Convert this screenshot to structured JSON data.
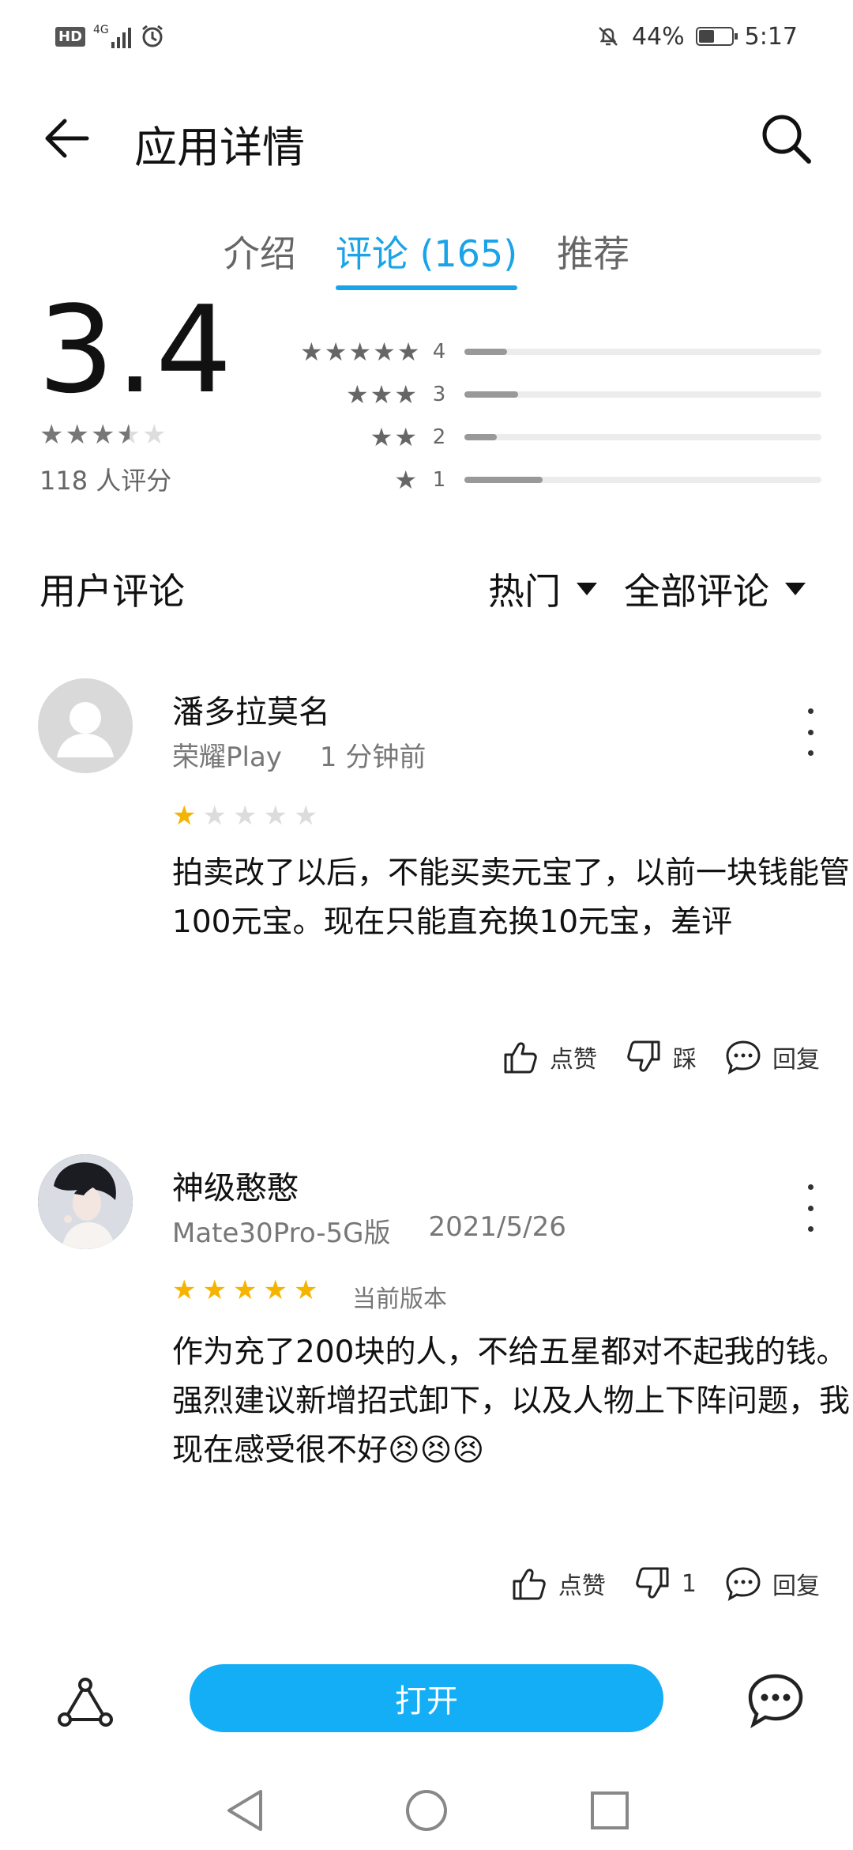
{
  "status": {
    "battery": "44%",
    "time": "5:17",
    "hd": "HD",
    "net": "4G"
  },
  "header": {
    "title": "应用详情"
  },
  "tabs": [
    {
      "label": "介绍"
    },
    {
      "label": "评论 (165)"
    },
    {
      "label": "推荐"
    }
  ],
  "rating": {
    "score": "3.4",
    "stars_value": 3.5,
    "count_text": "118 人评分",
    "distribution": [
      {
        "stars": "★★★★★",
        "count": "4",
        "fill": 0.12
      },
      {
        "stars": "★★★",
        "count": "3",
        "fill": 0.15
      },
      {
        "stars": "★★",
        "count": "2",
        "fill": 0.09
      },
      {
        "stars": "★",
        "count": "1",
        "fill": 0.22
      }
    ]
  },
  "reviews_header": {
    "title": "用户评论",
    "sort": "热门",
    "filter": "全部评论"
  },
  "reviews": [
    {
      "name": "潘多拉莫名",
      "device": "荣耀Play",
      "time": "1 分钟前",
      "stars": 1,
      "version": "",
      "text": "拍卖改了以后，不能买卖元宝了，以前一块钱能管100元宝。现在只能直充换10元宝，差评",
      "like_label": "点赞",
      "dislike_label": "踩",
      "reply_label": "回复"
    },
    {
      "name": "神级憨憨",
      "device": "Mate30Pro-5G版",
      "time": "2021/5/26",
      "stars": 5,
      "version": "当前版本",
      "text": "作为充了200块的人，不给五星都对不起我的钱。\n强烈建议新增招式卸下，以及人物上下阵问题，我现在感受很不好😣😣😣",
      "like_label": "点赞",
      "dislike_label": "1",
      "reply_label": "回复"
    }
  ],
  "bottom": {
    "open_label": "打开"
  },
  "colors": {
    "accent": "#1aa3e8",
    "button": "#13aef5",
    "star": "#f5b400"
  }
}
